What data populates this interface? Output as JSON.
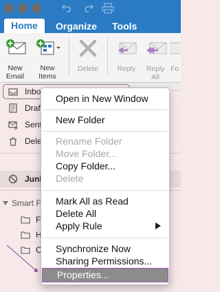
{
  "ribbon_tabs": [
    {
      "label": "Home",
      "active": true
    },
    {
      "label": "Organize",
      "active": false
    },
    {
      "label": "Tools",
      "active": false
    }
  ],
  "ribbon": {
    "new_email": "New\nEmail",
    "new_items": "New\nItems",
    "delete": "Delete",
    "reply": "Reply",
    "reply_all": "Reply\nAll",
    "forward_partial": "Fo"
  },
  "folders": {
    "inbox": "Inbo",
    "drafts": "Draf",
    "sent": "Sent",
    "deleted": "Dele",
    "junk": "Junk",
    "smart_folders": "Smart F",
    "smart_1": "Fl",
    "smart_2": "H",
    "smart_3": "O"
  },
  "context_menu": {
    "groups": [
      [
        {
          "label": "Open in New Window",
          "enabled": true
        }
      ],
      [
        {
          "label": "New Folder",
          "enabled": true
        }
      ],
      [
        {
          "label": "Rename Folder",
          "enabled": false
        },
        {
          "label": "Move Folder...",
          "enabled": false
        },
        {
          "label": "Copy Folder...",
          "enabled": true
        },
        {
          "label": "Delete",
          "enabled": false
        }
      ],
      [
        {
          "label": "Mark All as Read",
          "enabled": true
        },
        {
          "label": "Delete All",
          "enabled": true
        },
        {
          "label": "Apply Rule",
          "enabled": true,
          "submenu": true
        }
      ],
      [
        {
          "label": "Synchronize Now",
          "enabled": true
        },
        {
          "label": "Sharing Permissions...",
          "enabled": true
        }
      ],
      [
        {
          "label": "Properties...",
          "enabled": true,
          "highlighted": true
        }
      ]
    ]
  },
  "colors": {
    "tab_bar": "#2a7bc3",
    "pane_bg": "#f7e9ea",
    "highlight": "#8c8c8c",
    "annotation": "#8a3fa0"
  }
}
